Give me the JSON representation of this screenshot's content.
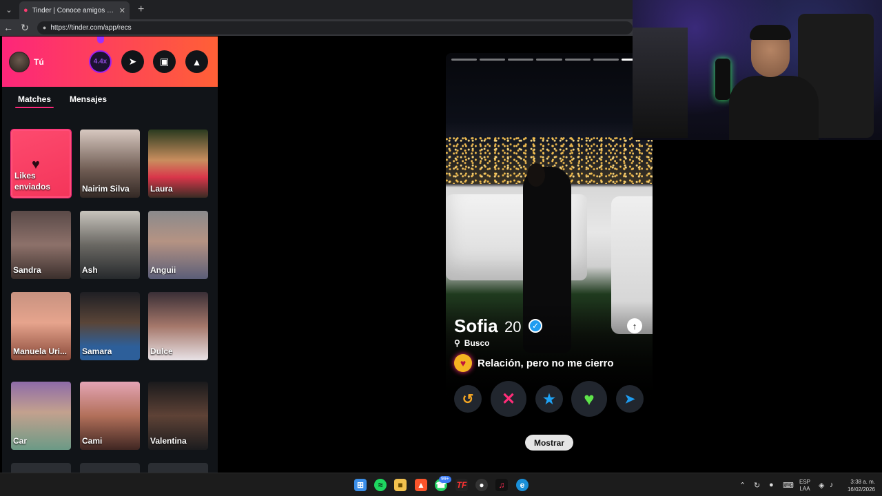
{
  "browser": {
    "tab_title": "Tinder | Conoce amigos y gente n",
    "url": "https://tinder.com/app/recs"
  },
  "sidebar": {
    "me_label": "Tú",
    "boost_label": "4.4x",
    "tabs": [
      {
        "label": "Matches",
        "active": true
      },
      {
        "label": "Mensajes",
        "active": false
      }
    ],
    "likes_sent_label": "Likes enviados",
    "matches": [
      {
        "name": "Nairim Silva"
      },
      {
        "name": "Laura"
      },
      {
        "name": "Sandra"
      },
      {
        "name": "Ash"
      },
      {
        "name": "Anguii"
      },
      {
        "name": "Manuela Uri..."
      },
      {
        "name": "Samara"
      },
      {
        "name": "Dulce"
      },
      {
        "name": "Car"
      },
      {
        "name": "Cami"
      },
      {
        "name": "Valentina"
      }
    ]
  },
  "profile": {
    "name": "Sofia",
    "age": "20",
    "busco_label": "Busco",
    "relationship": "Relación, pero no me cierro",
    "photo_count": 7,
    "current_photo": 7
  },
  "actions": {
    "rewind_icon": "rewind-icon",
    "nope_icon": "x-icon",
    "superlike_icon": "star-icon",
    "like_icon": "heart-icon",
    "boost_icon": "send-icon",
    "mostrar_label": "Mostrar"
  },
  "taskbar": {
    "teams_badge": "99+",
    "lang_top": "ESP",
    "lang_bottom": "LAA",
    "time": "3:38 a. m.",
    "date": "16/02/2026"
  },
  "colors": {
    "brand_gradient_start": "#fd267a",
    "brand_gradient_end": "#ff6036",
    "rewind": "#f5a623",
    "nope": "#ff2d78",
    "superlike": "#1fa3f5",
    "like": "#5ee44a",
    "boost": "#1e9cf0"
  }
}
